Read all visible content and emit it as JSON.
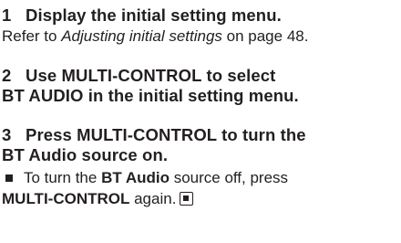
{
  "steps": [
    {
      "number": "1",
      "heading": "Display the initial setting menu.",
      "body_prefix": "Refer to ",
      "body_italic": "Adjusting initial settings",
      "body_suffix": " on page 48."
    },
    {
      "number": "2",
      "heading_line1": "Use MULTI-CONTROL to select",
      "heading_line2": "BT AUDIO in the initial setting menu."
    },
    {
      "number": "3",
      "heading_line1": "Press MULTI-CONTROL to turn the",
      "heading_line2": "BT Audio source on.",
      "bullet": {
        "part1": "To turn the ",
        "part2_bold": "BT Audio",
        "part3": " source off, press",
        "part4_bold": "MULTI-CONTROL",
        "part5": " again."
      }
    }
  ],
  "icons": {
    "bullet": "square-bullet-icon",
    "end": "end-of-section-icon"
  }
}
